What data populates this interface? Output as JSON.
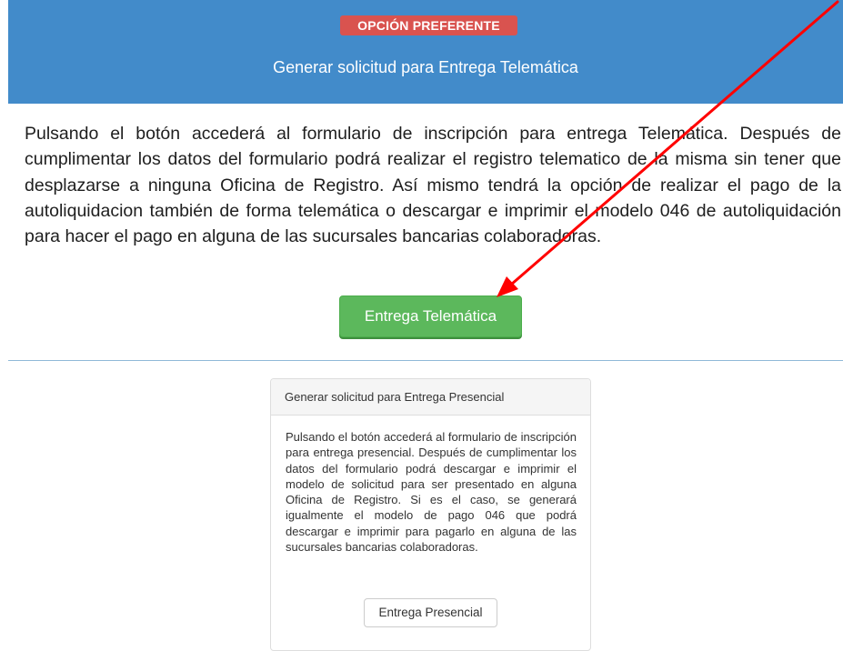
{
  "primary": {
    "badge": "OPCIÓN PREFERENTE",
    "title": "Generar solicitud para Entrega Telemática",
    "description": "Pulsando el botón accederá al formulario de inscripción para entrega Telemática. Después de cumplimentar los datos del formulario podrá realizar el registro telematico de la misma sin tener que desplazarse a ninguna Oficina de Registro. Así mismo tendrá la opción de realizar el pago de la autoliquidacion también de forma telemática o descargar e imprimir el modelo 046 de autoliquidación para hacer el pago en alguna de las sucursales bancarias colaboradoras.",
    "button_label": "Entrega Telemática"
  },
  "secondary": {
    "title": "Generar solicitud para Entrega Presencial",
    "description": "Pulsando el botón accederá al formulario de inscripción para entrega presencial. Después de cumplimentar los datos del formulario podrá descargar e imprimir el modelo de solicitud para ser presentado en alguna Oficina de Registro. Si es el caso, se generará igualmente el modelo de pago 046 que podrá descargar e imprimir para pagarlo en alguna de las sucursales bancarias colaboradoras.",
    "button_label": "Entrega Presencial"
  },
  "colors": {
    "header_blue": "#428bca",
    "badge_red": "#d9534f",
    "button_green": "#5cb85c",
    "annotation_arrow": "#ff0000"
  },
  "annotation": {
    "icon": "red-arrow-icon"
  }
}
